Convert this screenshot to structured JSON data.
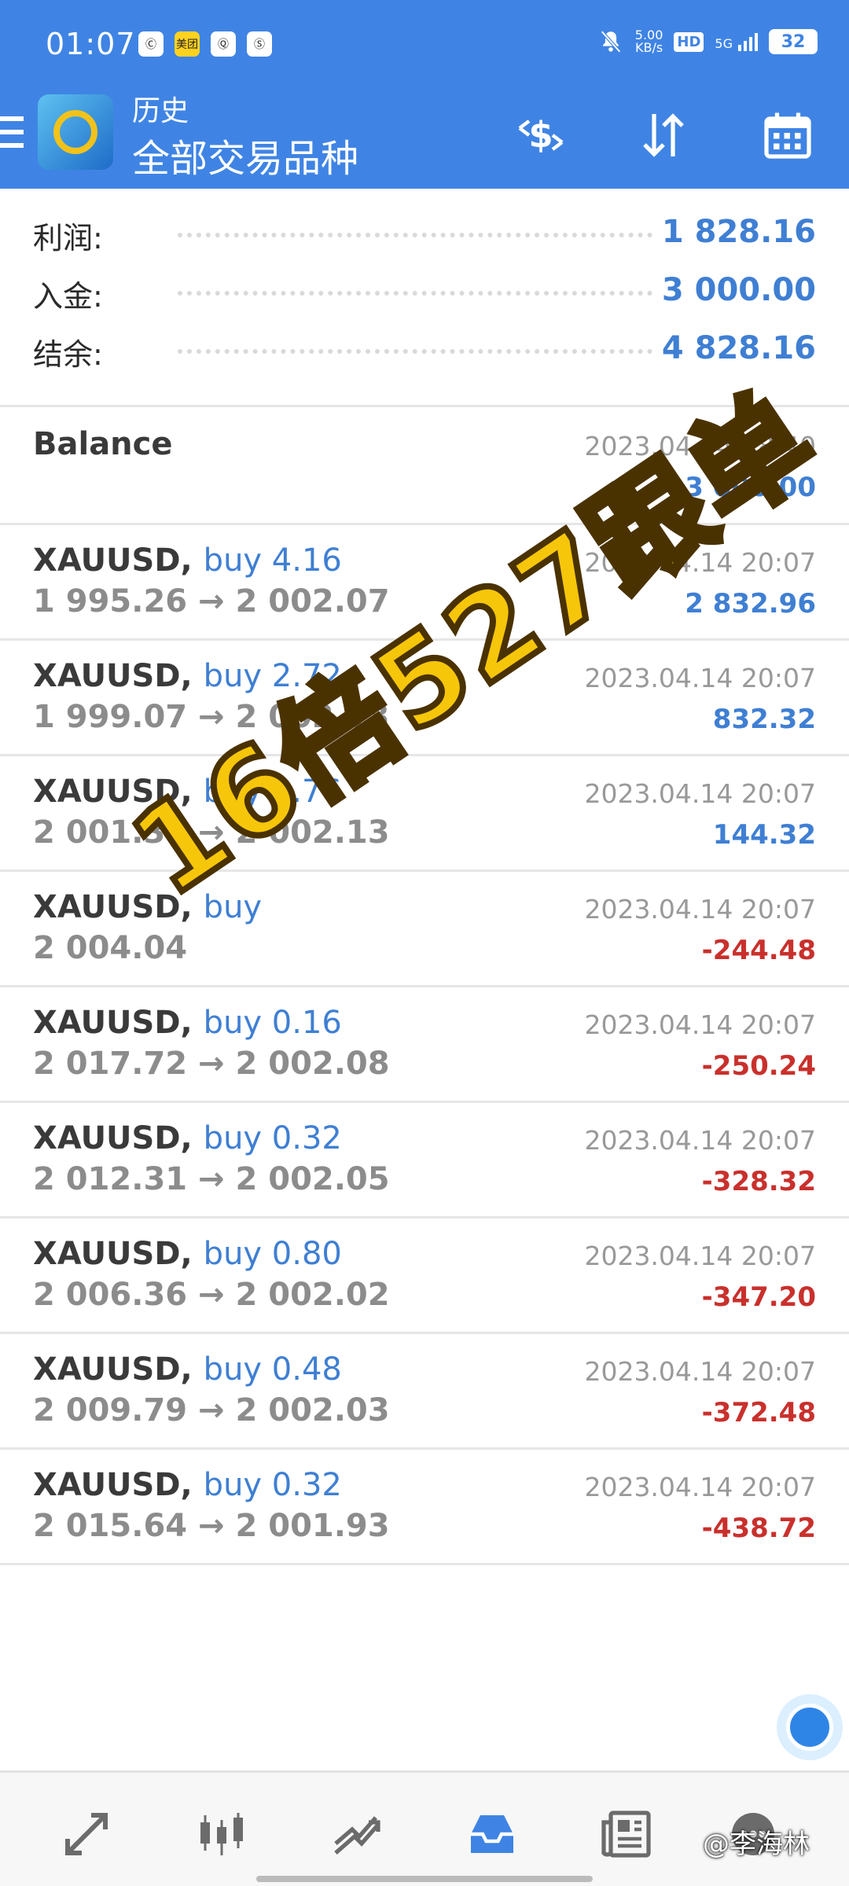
{
  "status_bar": {
    "time": "01:07",
    "left_apps": [
      "Ⓒ",
      "美团",
      "Ⓠ",
      "Ⓢ"
    ],
    "net_speed_value": "5.00",
    "net_speed_unit": "KB/s",
    "hd": "HD",
    "network": "5G",
    "battery": "32"
  },
  "app_bar": {
    "title": "历史",
    "subtitle": "全部交易品种"
  },
  "summary": [
    {
      "label": "利润:",
      "value": "1 828.16"
    },
    {
      "label": "入金:",
      "value": "3 000.00"
    },
    {
      "label": "结余:",
      "value": "4 828.16"
    }
  ],
  "balance": {
    "label": "Balance",
    "date": "2023.04.14 18:40",
    "amount": "3 000.00"
  },
  "deals": [
    {
      "symbol": "XAUUSD,",
      "action": "buy 4.16",
      "prices": "1 995.26 → 2 002.07",
      "date": "2023.04.14 20:07",
      "profit": "2 832.96",
      "sign": "pos"
    },
    {
      "symbol": "XAUUSD,",
      "action": "buy 2.72",
      "prices": "1 999.07 → 2 002.13",
      "date": "2023.04.14 20:07",
      "profit": "832.32",
      "sign": "pos"
    },
    {
      "symbol": "XAUUSD,",
      "action": "buy 1.76",
      "prices": "2 001.31 → 2 002.13",
      "date": "2023.04.14 20:07",
      "profit": "144.32",
      "sign": "pos"
    },
    {
      "symbol": "XAUUSD,",
      "action": "buy",
      "prices": "2 004.04",
      "date": "2023.04.14 20:07",
      "profit": "-244.48",
      "sign": "neg"
    },
    {
      "symbol": "XAUUSD,",
      "action": "buy 0.16",
      "prices": "2 017.72 → 2 002.08",
      "date": "2023.04.14 20:07",
      "profit": "-250.24",
      "sign": "neg"
    },
    {
      "symbol": "XAUUSD,",
      "action": "buy 0.32",
      "prices": "2 012.31 → 2 002.05",
      "date": "2023.04.14 20:07",
      "profit": "-328.32",
      "sign": "neg"
    },
    {
      "symbol": "XAUUSD,",
      "action": "buy 0.80",
      "prices": "2 006.36 → 2 002.02",
      "date": "2023.04.14 20:07",
      "profit": "-347.20",
      "sign": "neg"
    },
    {
      "symbol": "XAUUSD,",
      "action": "buy 0.48",
      "prices": "2 009.79 → 2 002.03",
      "date": "2023.04.14 20:07",
      "profit": "-372.48",
      "sign": "neg"
    },
    {
      "symbol": "XAUUSD,",
      "action": "buy 0.32",
      "prices": "2 015.64 → 2 001.93",
      "date": "2023.04.14 20:07",
      "profit": "-438.72",
      "sign": "neg"
    }
  ],
  "overlay_text": "16倍527跟单",
  "watermark_credit": "@李海林",
  "colors": {
    "accent": "#3f84e4",
    "positive": "#3f7fd3",
    "negative": "#c9302c",
    "overlay_fill": "#f6c60a"
  },
  "icons": {
    "app_bar": [
      "menu-icon",
      "currency-exchange-icon",
      "sort-icon",
      "calendar-icon"
    ],
    "bottom_nav": [
      "quotes-icon",
      "chart-icon",
      "trade-icon",
      "history-icon",
      "news-icon",
      "settings-icon"
    ]
  }
}
